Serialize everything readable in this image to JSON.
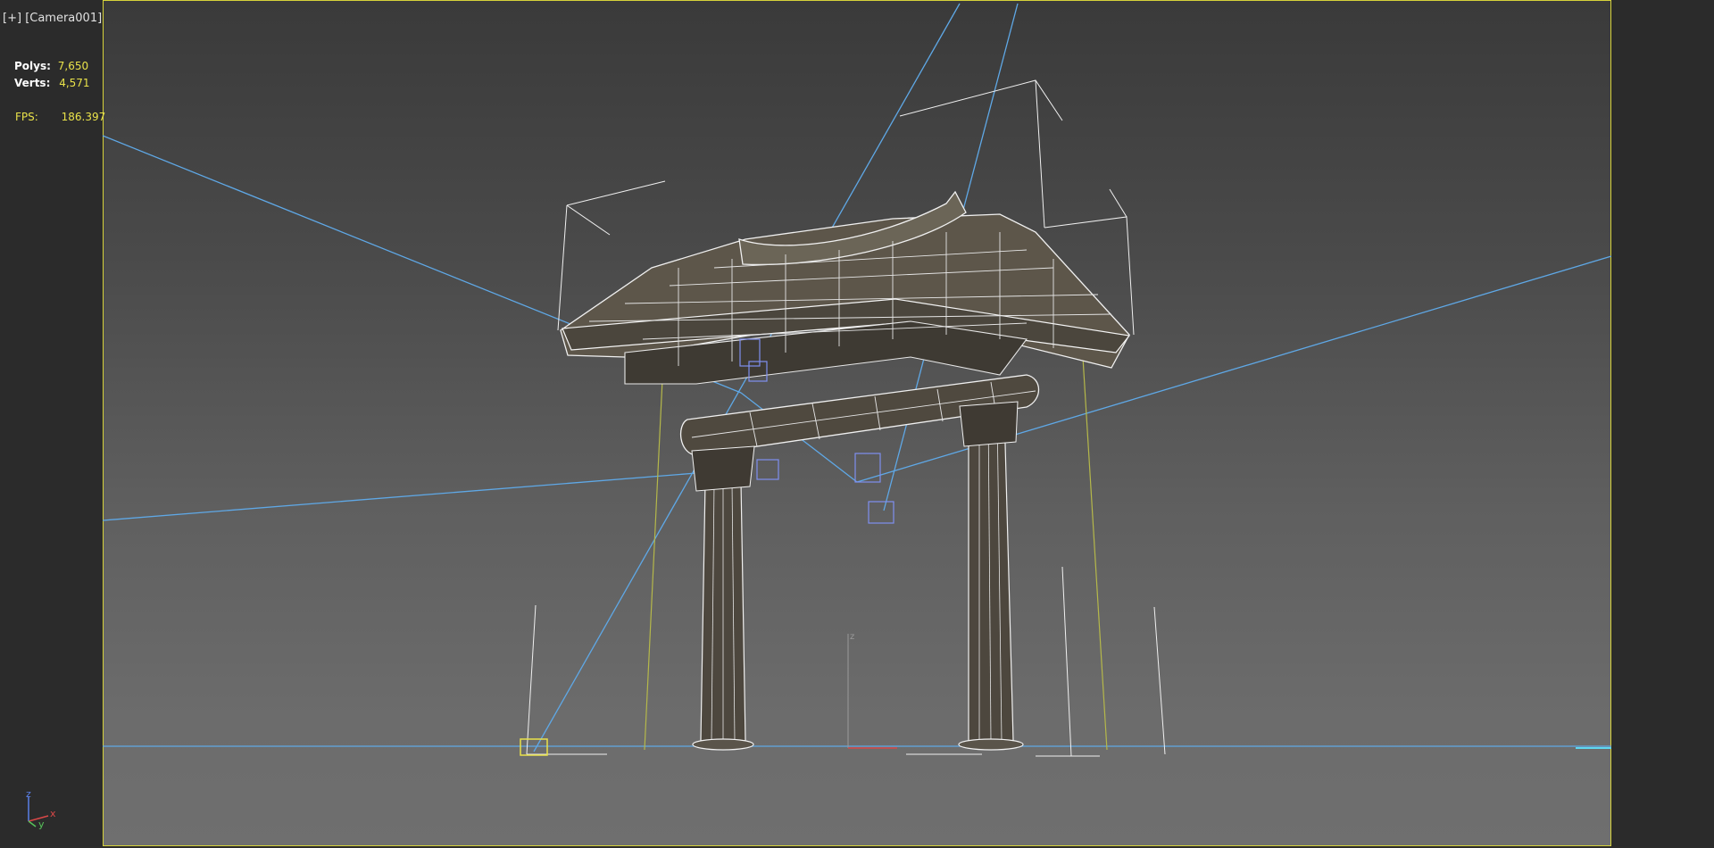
{
  "viewport": {
    "label_plus": "[+]",
    "label_camera": "[Camera001]"
  },
  "stats": {
    "polys_label": "Polys:",
    "polys_value": "7,650",
    "verts_label": "Verts:",
    "verts_value": "4,571",
    "fps_label": "FPS:",
    "fps_value": "186.397"
  },
  "axis": {
    "x": "x",
    "y": "y",
    "z": "z"
  },
  "colors": {
    "safe_frame": "#d6d23a",
    "wire": "#f2f2f2",
    "camera_lines": "#5fa8e6",
    "helpers": "#7f8ff0",
    "light_guides": "#b5b84a"
  }
}
